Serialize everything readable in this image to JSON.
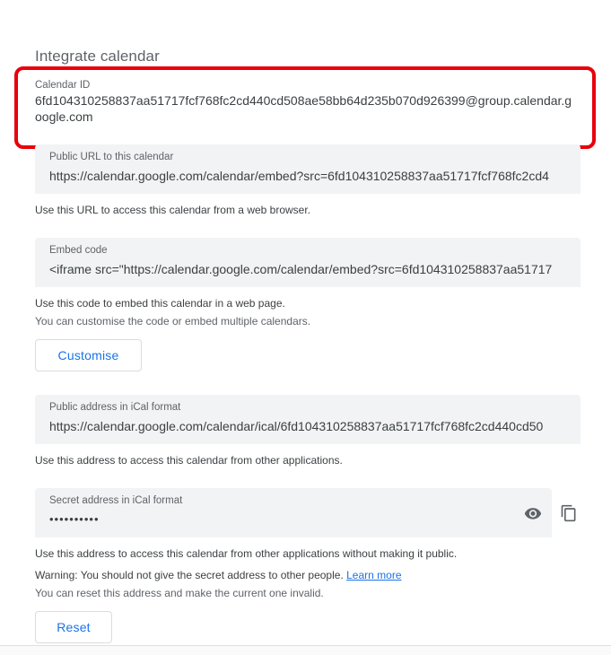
{
  "section": {
    "title": "Integrate calendar"
  },
  "calendar_id": {
    "label": "Calendar ID",
    "value_line1": "6fd104310258837aa51717fcf768fc2cd440cd508ae58bb64d235b070d926399@group.calendar.g",
    "value_line2": "oogle.com"
  },
  "public_url": {
    "label": "Public URL to this calendar",
    "value": "https://calendar.google.com/calendar/embed?src=6fd104310258837aa51717fcf768fc2cd4",
    "helper": "Use this URL to access this calendar from a web browser."
  },
  "embed_code": {
    "label": "Embed code",
    "value": "<iframe src=\"https://calendar.google.com/calendar/embed?src=6fd104310258837aa51717",
    "helper1": "Use this code to embed this calendar in a web page.",
    "helper2": "You can customise the code or embed multiple calendars.",
    "customise_label": "Customise"
  },
  "ical_public": {
    "label": "Public address in iCal format",
    "value": "https://calendar.google.com/calendar/ical/6fd104310258837aa51717fcf768fc2cd440cd50",
    "helper": "Use this address to access this calendar from other applications."
  },
  "ical_secret": {
    "label": "Secret address in iCal format",
    "value": "••••••••••",
    "show_icon": "eye-icon",
    "copy_icon": "copy-icon",
    "helper1": "Use this address to access this calendar from other applications without making it public.",
    "warning": "Warning: You should not give the secret address to other people.",
    "learn_more": "Learn more",
    "helper2": "You can reset this address and make the current one invalid.",
    "reset_label": "Reset"
  },
  "colors": {
    "highlight": "#e8000b",
    "link": "#1a73e8",
    "field_bg": "#f1f3f4",
    "text": "#3c4043",
    "muted": "#5f6368"
  }
}
